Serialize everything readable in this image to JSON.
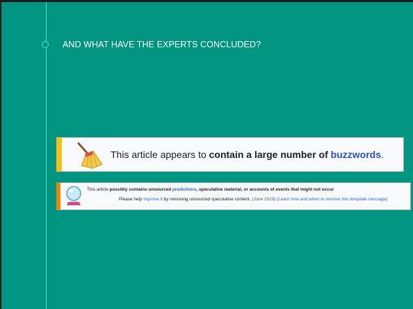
{
  "slide": {
    "title": "AND WHAT HAVE THE EXPERTS CONCLUDED?",
    "background_color": "#009481"
  },
  "notice_buzzwords": {
    "icon": "broom-icon",
    "text_prefix": "This article appears to ",
    "text_bold": "contain a large number of ",
    "link": "buzzwords",
    "text_suffix": ".",
    "accent_color": "#f4c11a"
  },
  "notice_speculative": {
    "icon": "crystal-ball-icon",
    "line1": {
      "prefix": "This article ",
      "bold": "possibly contains unsourced ",
      "link": "predictions",
      "bold_after": ", speculative material, or accounts of events that might not occur",
      "suffix": "."
    },
    "line2": {
      "prefix": "Please help ",
      "link": "improve it",
      "middle": " by removing unsourced speculative content. ",
      "date": "(June 2019)",
      "learn_link": "(Learn how and when to remove this template message)"
    },
    "accent_color": "#f28500"
  }
}
